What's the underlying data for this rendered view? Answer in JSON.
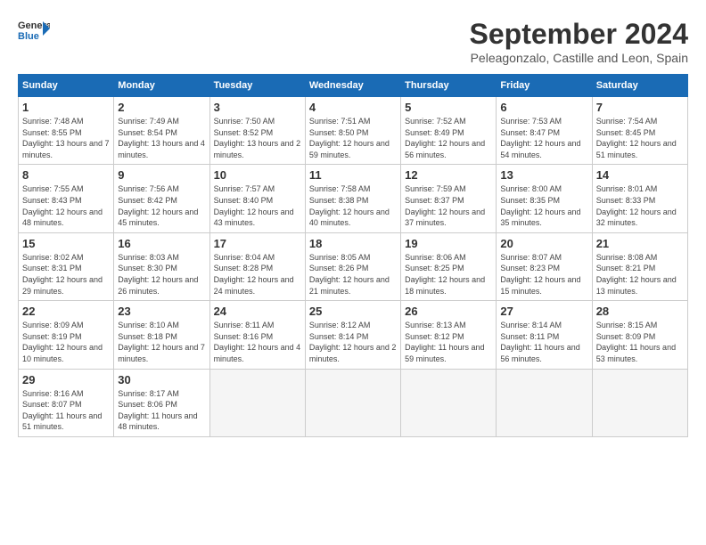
{
  "logo": {
    "line1": "General",
    "line2": "Blue"
  },
  "title": "September 2024",
  "location": "Peleagonzalo, Castille and Leon, Spain",
  "days_of_week": [
    "Sunday",
    "Monday",
    "Tuesday",
    "Wednesday",
    "Thursday",
    "Friday",
    "Saturday"
  ],
  "weeks": [
    [
      {
        "day": 1,
        "sunrise": "7:48 AM",
        "sunset": "8:55 PM",
        "daylight": "13 hours and 7 minutes."
      },
      {
        "day": 2,
        "sunrise": "7:49 AM",
        "sunset": "8:54 PM",
        "daylight": "13 hours and 4 minutes."
      },
      {
        "day": 3,
        "sunrise": "7:50 AM",
        "sunset": "8:52 PM",
        "daylight": "13 hours and 2 minutes."
      },
      {
        "day": 4,
        "sunrise": "7:51 AM",
        "sunset": "8:50 PM",
        "daylight": "12 hours and 59 minutes."
      },
      {
        "day": 5,
        "sunrise": "7:52 AM",
        "sunset": "8:49 PM",
        "daylight": "12 hours and 56 minutes."
      },
      {
        "day": 6,
        "sunrise": "7:53 AM",
        "sunset": "8:47 PM",
        "daylight": "12 hours and 54 minutes."
      },
      {
        "day": 7,
        "sunrise": "7:54 AM",
        "sunset": "8:45 PM",
        "daylight": "12 hours and 51 minutes."
      }
    ],
    [
      {
        "day": 8,
        "sunrise": "7:55 AM",
        "sunset": "8:43 PM",
        "daylight": "12 hours and 48 minutes."
      },
      {
        "day": 9,
        "sunrise": "7:56 AM",
        "sunset": "8:42 PM",
        "daylight": "12 hours and 45 minutes."
      },
      {
        "day": 10,
        "sunrise": "7:57 AM",
        "sunset": "8:40 PM",
        "daylight": "12 hours and 43 minutes."
      },
      {
        "day": 11,
        "sunrise": "7:58 AM",
        "sunset": "8:38 PM",
        "daylight": "12 hours and 40 minutes."
      },
      {
        "day": 12,
        "sunrise": "7:59 AM",
        "sunset": "8:37 PM",
        "daylight": "12 hours and 37 minutes."
      },
      {
        "day": 13,
        "sunrise": "8:00 AM",
        "sunset": "8:35 PM",
        "daylight": "12 hours and 35 minutes."
      },
      {
        "day": 14,
        "sunrise": "8:01 AM",
        "sunset": "8:33 PM",
        "daylight": "12 hours and 32 minutes."
      }
    ],
    [
      {
        "day": 15,
        "sunrise": "8:02 AM",
        "sunset": "8:31 PM",
        "daylight": "12 hours and 29 minutes."
      },
      {
        "day": 16,
        "sunrise": "8:03 AM",
        "sunset": "8:30 PM",
        "daylight": "12 hours and 26 minutes."
      },
      {
        "day": 17,
        "sunrise": "8:04 AM",
        "sunset": "8:28 PM",
        "daylight": "12 hours and 24 minutes."
      },
      {
        "day": 18,
        "sunrise": "8:05 AM",
        "sunset": "8:26 PM",
        "daylight": "12 hours and 21 minutes."
      },
      {
        "day": 19,
        "sunrise": "8:06 AM",
        "sunset": "8:25 PM",
        "daylight": "12 hours and 18 minutes."
      },
      {
        "day": 20,
        "sunrise": "8:07 AM",
        "sunset": "8:23 PM",
        "daylight": "12 hours and 15 minutes."
      },
      {
        "day": 21,
        "sunrise": "8:08 AM",
        "sunset": "8:21 PM",
        "daylight": "12 hours and 13 minutes."
      }
    ],
    [
      {
        "day": 22,
        "sunrise": "8:09 AM",
        "sunset": "8:19 PM",
        "daylight": "12 hours and 10 minutes."
      },
      {
        "day": 23,
        "sunrise": "8:10 AM",
        "sunset": "8:18 PM",
        "daylight": "12 hours and 7 minutes."
      },
      {
        "day": 24,
        "sunrise": "8:11 AM",
        "sunset": "8:16 PM",
        "daylight": "12 hours and 4 minutes."
      },
      {
        "day": 25,
        "sunrise": "8:12 AM",
        "sunset": "8:14 PM",
        "daylight": "12 hours and 2 minutes."
      },
      {
        "day": 26,
        "sunrise": "8:13 AM",
        "sunset": "8:12 PM",
        "daylight": "11 hours and 59 minutes."
      },
      {
        "day": 27,
        "sunrise": "8:14 AM",
        "sunset": "8:11 PM",
        "daylight": "11 hours and 56 minutes."
      },
      {
        "day": 28,
        "sunrise": "8:15 AM",
        "sunset": "8:09 PM",
        "daylight": "11 hours and 53 minutes."
      }
    ],
    [
      {
        "day": 29,
        "sunrise": "8:16 AM",
        "sunset": "8:07 PM",
        "daylight": "11 hours and 51 minutes."
      },
      {
        "day": 30,
        "sunrise": "8:17 AM",
        "sunset": "8:06 PM",
        "daylight": "11 hours and 48 minutes."
      },
      null,
      null,
      null,
      null,
      null
    ]
  ]
}
